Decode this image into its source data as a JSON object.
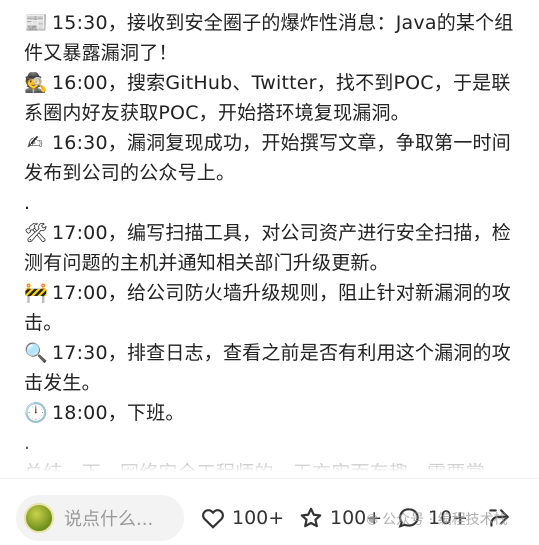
{
  "article": {
    "lines": [
      {
        "emoji": "📰",
        "emoji_name": "newspaper-icon",
        "text": "15:30，接收到安全圈子的爆炸性消息：Java的某个组件又暴露漏洞了！"
      },
      {
        "emoji": "🕵",
        "emoji_name": "detective-icon",
        "text": "16:00，搜索GitHub、Twitter，找不到POC，于是联系圈内好友获取POC，开始搭环境复现漏洞。"
      },
      {
        "emoji": "✍",
        "emoji_name": "writing-hand-icon",
        "text": "16:30，漏洞复现成功，开始撰写文章，争取第一时间发布到公司的公众号上。"
      },
      {
        "dot": "."
      },
      {
        "emoji": "🛠",
        "emoji_name": "tools-icon",
        "text": "17:00，编写扫描工具，对公司资产进行安全扫描，检测有问题的主机并通知相关部门升级更新。"
      },
      {
        "emoji": "🚧",
        "emoji_name": "construction-barrier-icon",
        "text": "17:00，给公司防火墙升级规则，阻止针对新漏洞的攻击。"
      },
      {
        "emoji": "🔍",
        "emoji_name": "magnifier-icon",
        "text": "17:30，排查日志，查看之前是否有利用这个漏洞的攻击发生。"
      },
      {
        "emoji": "🕛",
        "emoji_name": "clock-icon",
        "text": "18:00，下班。"
      },
      {
        "dot": "."
      },
      {
        "text": "总结一下，网络安全工程师的一天充实而有趣，需要掌"
      }
    ]
  },
  "bottom_bar": {
    "comment_placeholder": "说点什么...",
    "like_count": "100+",
    "favorite_count": "100+",
    "comment_count": "10+",
    "watermark": "公众号 · 编程技术栈"
  }
}
